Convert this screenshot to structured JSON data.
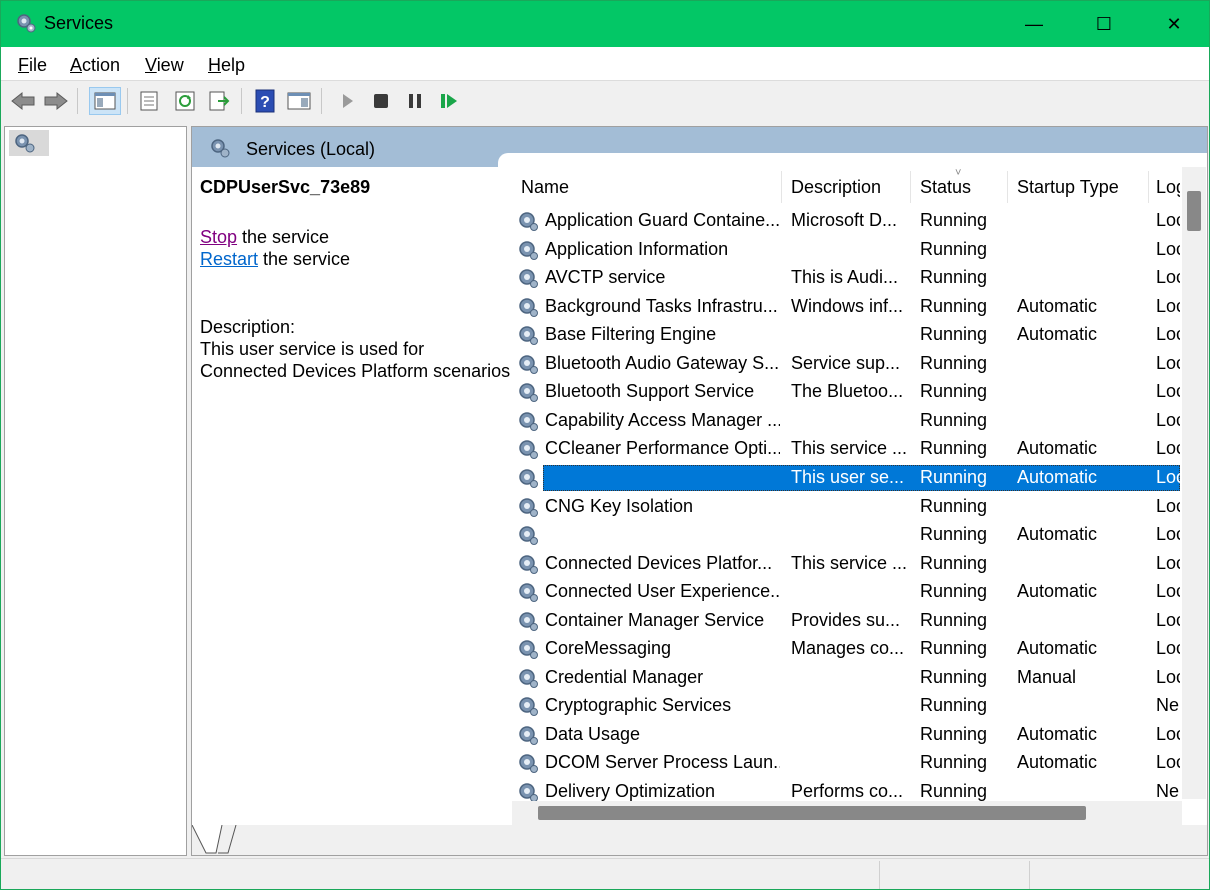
{
  "window": {
    "title": "Services",
    "minimize": "—",
    "maximize": "☐",
    "close": "✕",
    "titlebar_color": "#03c766"
  },
  "menu": {
    "items": [
      {
        "pre": "",
        "ul": "F",
        "post": "ile"
      },
      {
        "pre": "",
        "ul": "A",
        "post": "ction"
      },
      {
        "pre": "",
        "ul": "V",
        "post": "iew"
      },
      {
        "pre": "",
        "ul": "H",
        "post": "elp"
      }
    ]
  },
  "toolbar": {
    "icons": [
      "back-arrow-icon",
      "forward-arrow-icon",
      "show-hide-console-tree-icon",
      "properties-icon",
      "refresh-icon",
      "export-list-icon",
      "help-icon",
      "show-action-pane-icon",
      "start-service-icon",
      "stop-service-icon",
      "pause-service-icon",
      "resume-service-icon"
    ]
  },
  "pane": {
    "header_title": "Services (Local)"
  },
  "extended": {
    "service_name": "CDPUserSvc_73e89",
    "stop_link": "Stop",
    "stop_suffix": " the service",
    "restart_link": "Restart",
    "restart_suffix": " the service",
    "description_label": "Description:",
    "description_line1": "This user service is used for",
    "description_line2": "Connected Devices Platform scenarios"
  },
  "table": {
    "columns": [
      "Name",
      "Description",
      "Status",
      "Startup Type",
      "Log"
    ],
    "sort_indicator": "˅",
    "rows": [
      [
        "Application Guard Containe...",
        "Microsoft D...",
        "Running",
        "",
        "Loc"
      ],
      [
        "Application Information",
        "",
        "Running",
        "",
        "Loc"
      ],
      [
        "AVCTP service",
        "This is Audi...",
        "Running",
        "",
        "Loc"
      ],
      [
        "Background Tasks Infrastru...",
        "Windows inf...",
        "Running",
        "Automatic",
        "Loc"
      ],
      [
        "Base Filtering Engine",
        "",
        "Running",
        "Automatic",
        "Loc"
      ],
      [
        "Bluetooth Audio Gateway S...",
        "Service sup...",
        "Running",
        "",
        "Loc"
      ],
      [
        "Bluetooth Support Service",
        "The Bluetoo...",
        "Running",
        "",
        "Loc"
      ],
      [
        "Capability Access Manager ...",
        "",
        "Running",
        "",
        "Loc"
      ],
      [
        "CCleaner Performance Opti...",
        "This service ...",
        "Running",
        "Automatic",
        "Loc"
      ],
      [
        "",
        "This user se...",
        "Running",
        "Automatic",
        "Loc"
      ],
      [
        "CNG Key Isolation",
        "",
        "Running",
        "",
        "Loc"
      ],
      [
        "",
        "",
        "Running",
        "Automatic",
        "Loc"
      ],
      [
        "Connected Devices Platfor...",
        "This service ...",
        "Running",
        "",
        "Loc"
      ],
      [
        "Connected User Experience...",
        "",
        "Running",
        "Automatic",
        "Loc"
      ],
      [
        "Container Manager Service",
        "Provides su...",
        "Running",
        "",
        "Loc"
      ],
      [
        "CoreMessaging",
        "Manages co...",
        "Running",
        "Automatic",
        "Loc"
      ],
      [
        "Credential Manager",
        "",
        "Running",
        "Manual",
        "Loc"
      ],
      [
        "Cryptographic Services",
        "",
        "Running",
        "",
        "Ne"
      ],
      [
        "Data Usage",
        "",
        "Running",
        "Automatic",
        "Loc"
      ],
      [
        "DCOM Server Process Laun...",
        "",
        "Running",
        "Automatic",
        "Loc"
      ],
      [
        "Delivery Optimization",
        "Performs co...",
        "Running",
        "",
        "Ne"
      ]
    ],
    "selected_index": 9,
    "selection_color": "#0078d7"
  }
}
